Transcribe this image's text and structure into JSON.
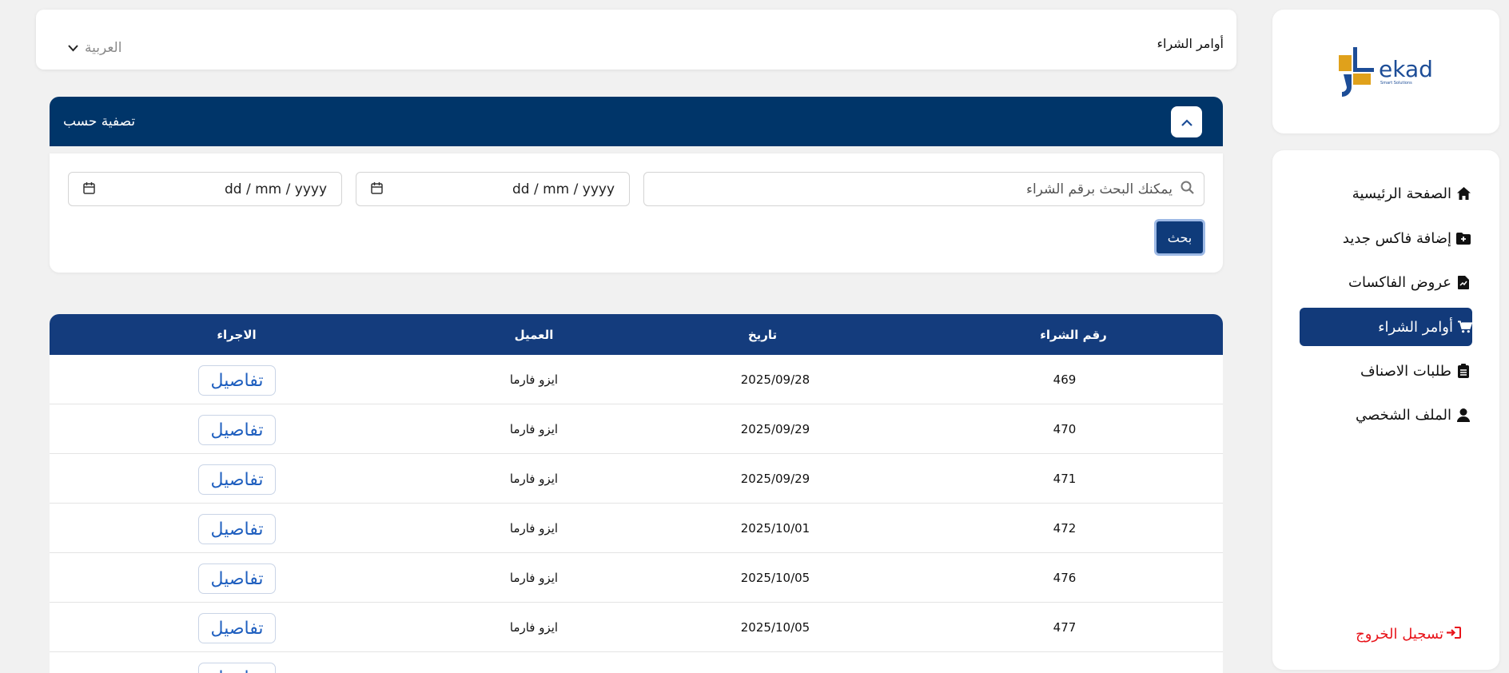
{
  "brand": {
    "name": "ekad",
    "tagline": "Smart Solutions",
    "colors": {
      "gold": "#e0a11b",
      "blue": "#1d4d97"
    }
  },
  "sidebar": {
    "items": [
      {
        "label": "الصفحة الرئيسية",
        "icon": "home-icon",
        "active": false
      },
      {
        "label": "إضافة فاكس جديد",
        "icon": "folder-plus-icon",
        "active": false
      },
      {
        "label": "عروض الفاكسات",
        "icon": "file-chart-icon",
        "active": false
      },
      {
        "label": "أوامر الشراء",
        "icon": "cart-icon",
        "active": true
      },
      {
        "label": "طلبات الاصناف",
        "icon": "clipboard-list-icon",
        "active": false
      },
      {
        "label": "الملف الشخصي",
        "icon": "user-icon",
        "active": false
      }
    ],
    "logout": "تسجيل الخروج"
  },
  "header": {
    "title": "أوامر الشراء",
    "language": "العربية"
  },
  "filter": {
    "title": "تصفية حسب",
    "search_placeholder": "يمكنك البحث برقم الشراء",
    "date_from": "dd / mm / yyyy",
    "date_to": "dd / mm / yyyy",
    "search_button": "بحث"
  },
  "table": {
    "columns": [
      "رقم الشراء",
      "تاريخ",
      "العميل",
      "الاجراء"
    ],
    "action_label": "تفاصيل",
    "rows": [
      {
        "number": "469",
        "date": "2025/09/28",
        "client": "ايزو فارما"
      },
      {
        "number": "470",
        "date": "2025/09/29",
        "client": "ايزو فارما"
      },
      {
        "number": "471",
        "date": "2025/09/29",
        "client": "ايزو فارما"
      },
      {
        "number": "472",
        "date": "2025/10/01",
        "client": "ايزو فارما"
      },
      {
        "number": "476",
        "date": "2025/10/05",
        "client": "ايزو فارما"
      },
      {
        "number": "477",
        "date": "2025/10/05",
        "client": "ايزو فارما"
      }
    ]
  },
  "colors": {
    "primary": "#143c7d",
    "filter_header": "#003569",
    "logout": "#e8141b",
    "link": "#1f5fbf"
  }
}
